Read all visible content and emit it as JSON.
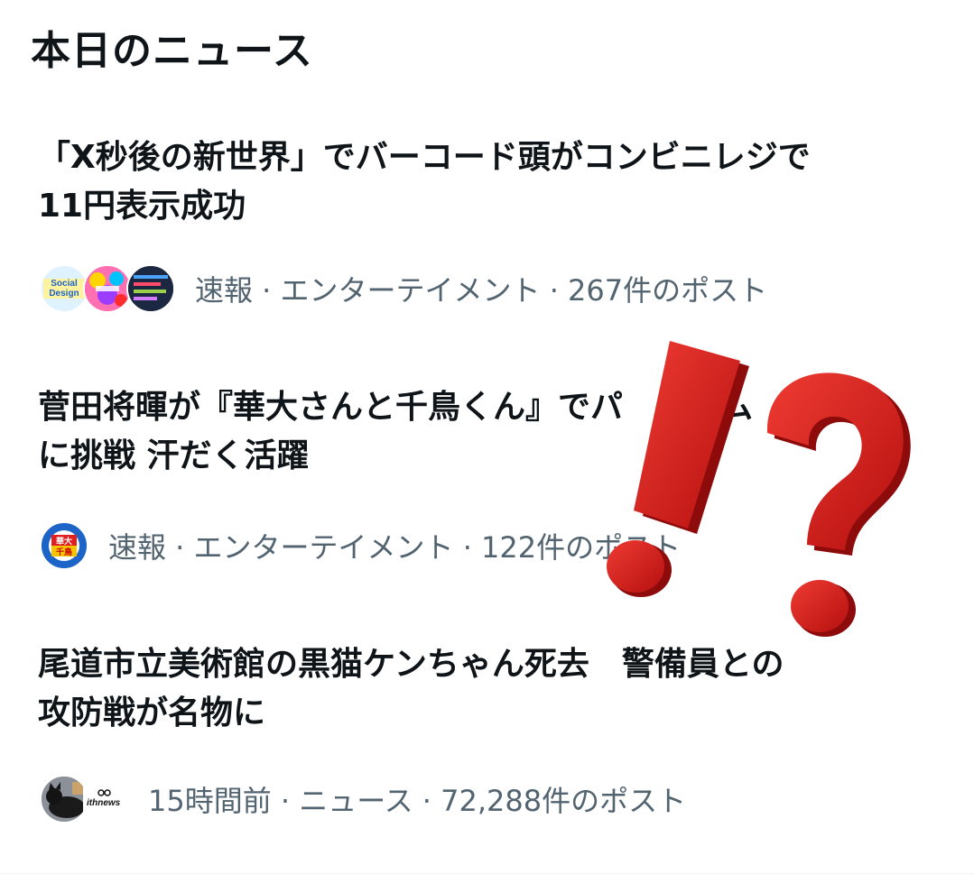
{
  "section": {
    "title": "本日のニュース"
  },
  "news": [
    {
      "headline_line1": "「X秒後の新世界」でバーコード頭がコンビニレジで",
      "headline_line2": "11円表示成功",
      "meta": "速報 · エンターテイメント · 267件のポスト",
      "avatars": [
        "social-design-avatar",
        "colorful-avatar",
        "screen-avatar"
      ],
      "avatar_text": [
        "Social",
        "Design"
      ]
    },
    {
      "headline_line1": "菅田将暉が『華大さんと千鳥くん』でパ　ー　ム",
      "headline_line2": "に挑戦 汗だく活躍",
      "meta": "速報 · エンターテイメント · 122件のポスト",
      "avatars": [
        "show-logo-avatar"
      ],
      "avatar_text": [
        "華大",
        "千鳥"
      ]
    },
    {
      "headline_line1": "尾道市立美術館の黒猫ケンちゃん死去　警備員との",
      "headline_line2": "攻防戦が名物に",
      "meta": "15時間前 · ニュース · 72,288件のポスト",
      "avatars": [
        "cat-avatar",
        "ithnews-logo"
      ],
      "avatar_text": [
        "ithnews"
      ]
    }
  ],
  "overlay": {
    "icon": "exclamation-question-icon",
    "color": "#d7191c"
  }
}
